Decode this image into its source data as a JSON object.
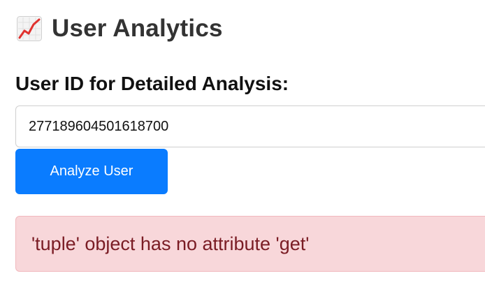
{
  "header": {
    "icon": "chart-increasing-icon",
    "title": "User Analytics"
  },
  "form": {
    "label": "User ID for Detailed Analysis:",
    "user_id_value": "277189604501618700",
    "button_label": "Analyze User"
  },
  "error": {
    "message": "'tuple' object has no attribute 'get'"
  },
  "colors": {
    "accent": "#0a7cff",
    "error_background": "#f8d7da",
    "error_text": "#7a1c24"
  }
}
